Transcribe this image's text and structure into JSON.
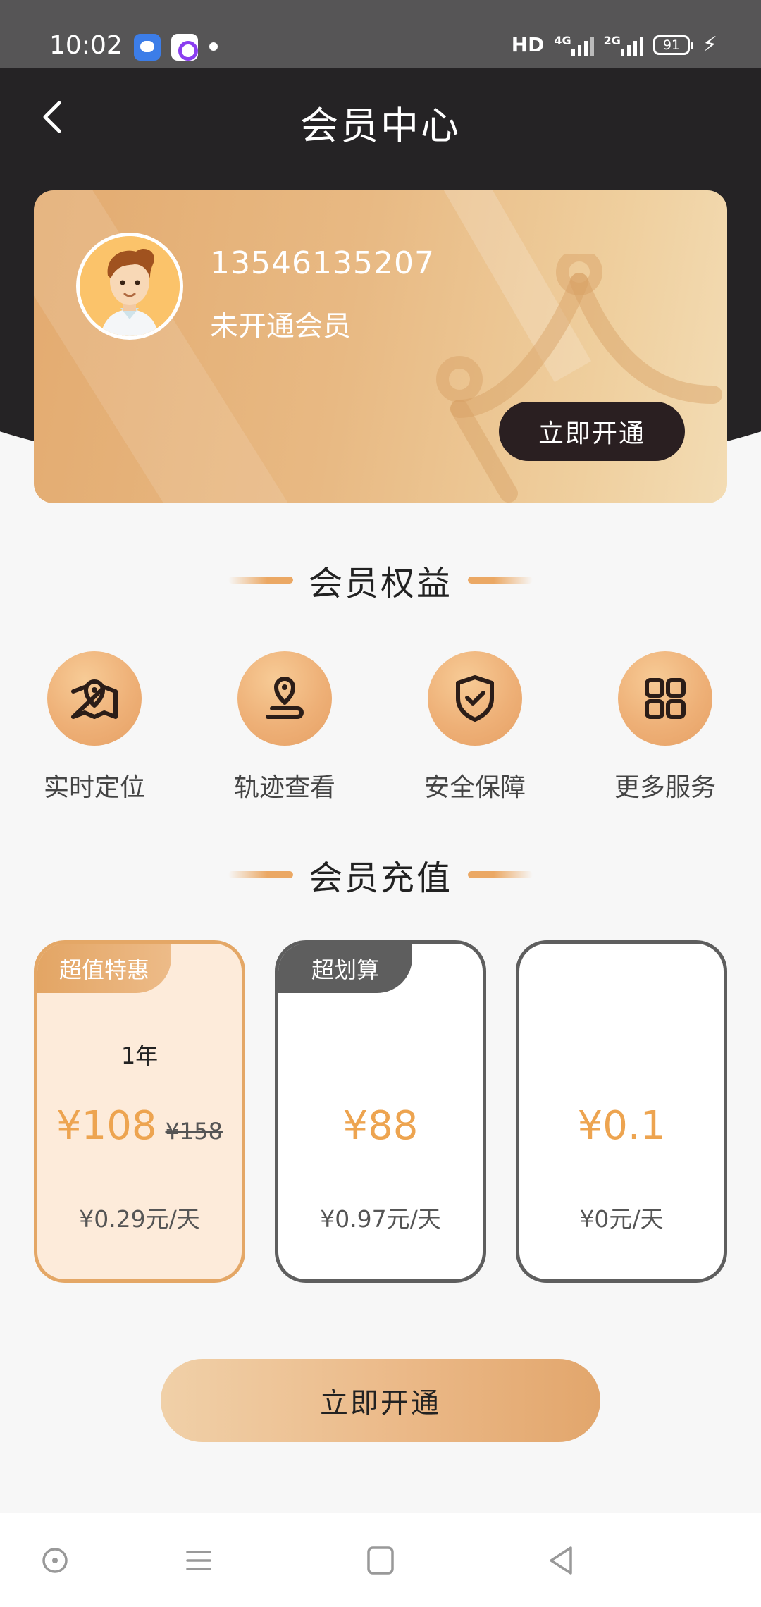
{
  "status_bar": {
    "time": "10:02",
    "network_label": "HD",
    "signal1_label": "4G",
    "signal2_label": "2G",
    "battery_level": "91"
  },
  "header": {
    "title": "会员中心",
    "back_icon": "chevron-left-icon"
  },
  "member_card": {
    "phone": "13546135207",
    "status": "未开通会员",
    "button_label": "立即开通",
    "avatar_icon": "cartoon-man-avatar"
  },
  "benefits": {
    "title": "会员权益",
    "items": [
      {
        "label": "实时定位",
        "icon": "map-pin-icon"
      },
      {
        "label": "轨迹查看",
        "icon": "location-track-icon"
      },
      {
        "label": "安全保障",
        "icon": "shield-check-icon"
      },
      {
        "label": "更多服务",
        "icon": "grid-icon"
      }
    ]
  },
  "recharge": {
    "title": "会员充值",
    "plans": [
      {
        "badge": "超值特惠",
        "name": "1年",
        "price": "¥108",
        "original_price": "¥158",
        "daily": "¥0.29元/天",
        "selected": true
      },
      {
        "badge": "超划算",
        "name": "",
        "price": "¥88",
        "original_price": "",
        "daily": "¥0.97元/天",
        "selected": false
      },
      {
        "badge": "",
        "name": "",
        "price": "¥0.1",
        "original_price": "",
        "daily": "¥0元/天",
        "selected": false
      }
    ]
  },
  "submit_button_label": "立即开通",
  "colors": {
    "accent": "#eda450",
    "dark_header": "#252325",
    "card_gold": "#e8b983",
    "selected_border": "#e4a766",
    "unselected_border": "#5e5e5e"
  },
  "system_nav": [
    "circle-icon",
    "menu-icon",
    "square-icon",
    "triangle-back-icon"
  ]
}
